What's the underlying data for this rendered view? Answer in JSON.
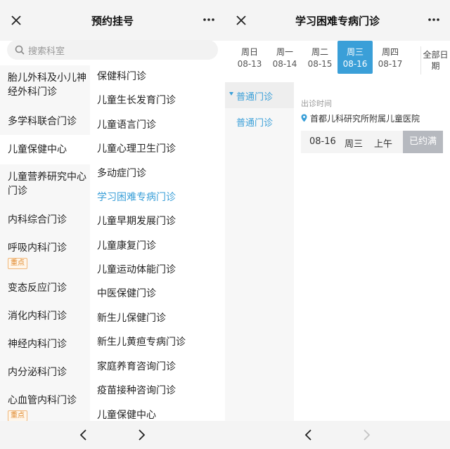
{
  "left": {
    "title": "预约挂号",
    "search_placeholder": "搜索科室",
    "categories": [
      {
        "label": "胎儿外科及小儿神经外科门诊"
      },
      {
        "label": "多学科联合门诊"
      },
      {
        "label": "儿童保健中心",
        "active": true
      },
      {
        "label": "儿童营养研究中心门诊"
      },
      {
        "label": "内科综合门诊"
      },
      {
        "label": "呼吸内科门诊",
        "badge": "重点"
      },
      {
        "label": "变态反应门诊"
      },
      {
        "label": "消化内科门诊"
      },
      {
        "label": "神经内科门诊"
      },
      {
        "label": "内分泌科门诊"
      },
      {
        "label": "心血管内科门诊",
        "badge": "重点"
      }
    ],
    "departments": [
      "保健科门诊",
      "儿童生长发育门诊",
      "儿童语言门诊",
      "儿童心理卫生门诊",
      "多动症门诊",
      "学习困难专病门诊",
      "儿童早期发展门诊",
      "儿童康复门诊",
      "儿童运动体能门诊",
      "中医保健门诊",
      "新生儿保健门诊",
      "新生儿黄疸专病门诊",
      "家庭养育咨询门诊",
      "疫苗接种咨询门诊",
      "儿童保健中心"
    ],
    "active_department": "学习困难专病门诊"
  },
  "right": {
    "title": "学习困难专病门诊",
    "dates": [
      {
        "week": "周日",
        "date": "08-13"
      },
      {
        "week": "周一",
        "date": "08-14"
      },
      {
        "week": "周二",
        "date": "08-15"
      },
      {
        "week": "周三",
        "date": "08-16",
        "active": true
      },
      {
        "week": "周四",
        "date": "08-17"
      }
    ],
    "all_dates": "全部日期",
    "clinic_types": {
      "header": "普通门诊",
      "item": "普通门诊"
    },
    "clinic_time_label": "出诊时间",
    "location": "首都儿科研究所附属儿童医院",
    "slot": {
      "date": "08-16",
      "week": "周三",
      "period": "上午",
      "status": "已约满"
    }
  },
  "colors": {
    "accent": "#3a9fd8",
    "badge": "#e08a2e",
    "full": "#b6b9bf"
  },
  "icons": [
    "close-icon",
    "more-icon",
    "search-icon",
    "location-pin-icon",
    "back-arrow-icon",
    "forward-arrow-icon",
    "triangle-down-icon"
  ]
}
